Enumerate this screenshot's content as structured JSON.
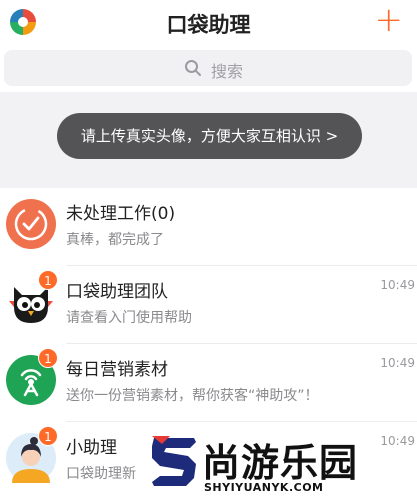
{
  "header": {
    "title": "口袋助理",
    "add_icon": "plus-icon",
    "logo_icon": "app-logo-icon"
  },
  "search": {
    "placeholder": "搜索",
    "icon": "search-icon"
  },
  "toast": {
    "text": "请上传真实头像，方便大家互相认识 >"
  },
  "conversations": [
    {
      "name": "未处理工作(0)",
      "preview": "真棒，都完成了",
      "time": "",
      "badge": "",
      "icon": "check-circle-icon",
      "color": "#f0714e"
    },
    {
      "name": "口袋助理团队",
      "preview": "请查看入门使用帮助",
      "time": "10:49",
      "badge": "1",
      "icon": "owl-icon",
      "color": "#222222"
    },
    {
      "name": "每日营销素材",
      "preview": "送你一份营销素材，帮你获客“神助攻”！",
      "time": "10:49",
      "badge": "1",
      "icon": "broadcast-icon",
      "color": "#1fa354"
    },
    {
      "name": "小助理",
      "preview": "口袋助理新",
      "time": "10:49",
      "badge": "1",
      "icon": "assistant-avatar-icon",
      "color": "#4a90e2"
    }
  ],
  "watermark": {
    "brand": "尚游乐园",
    "url": "SHYIYUANYK.COM"
  }
}
